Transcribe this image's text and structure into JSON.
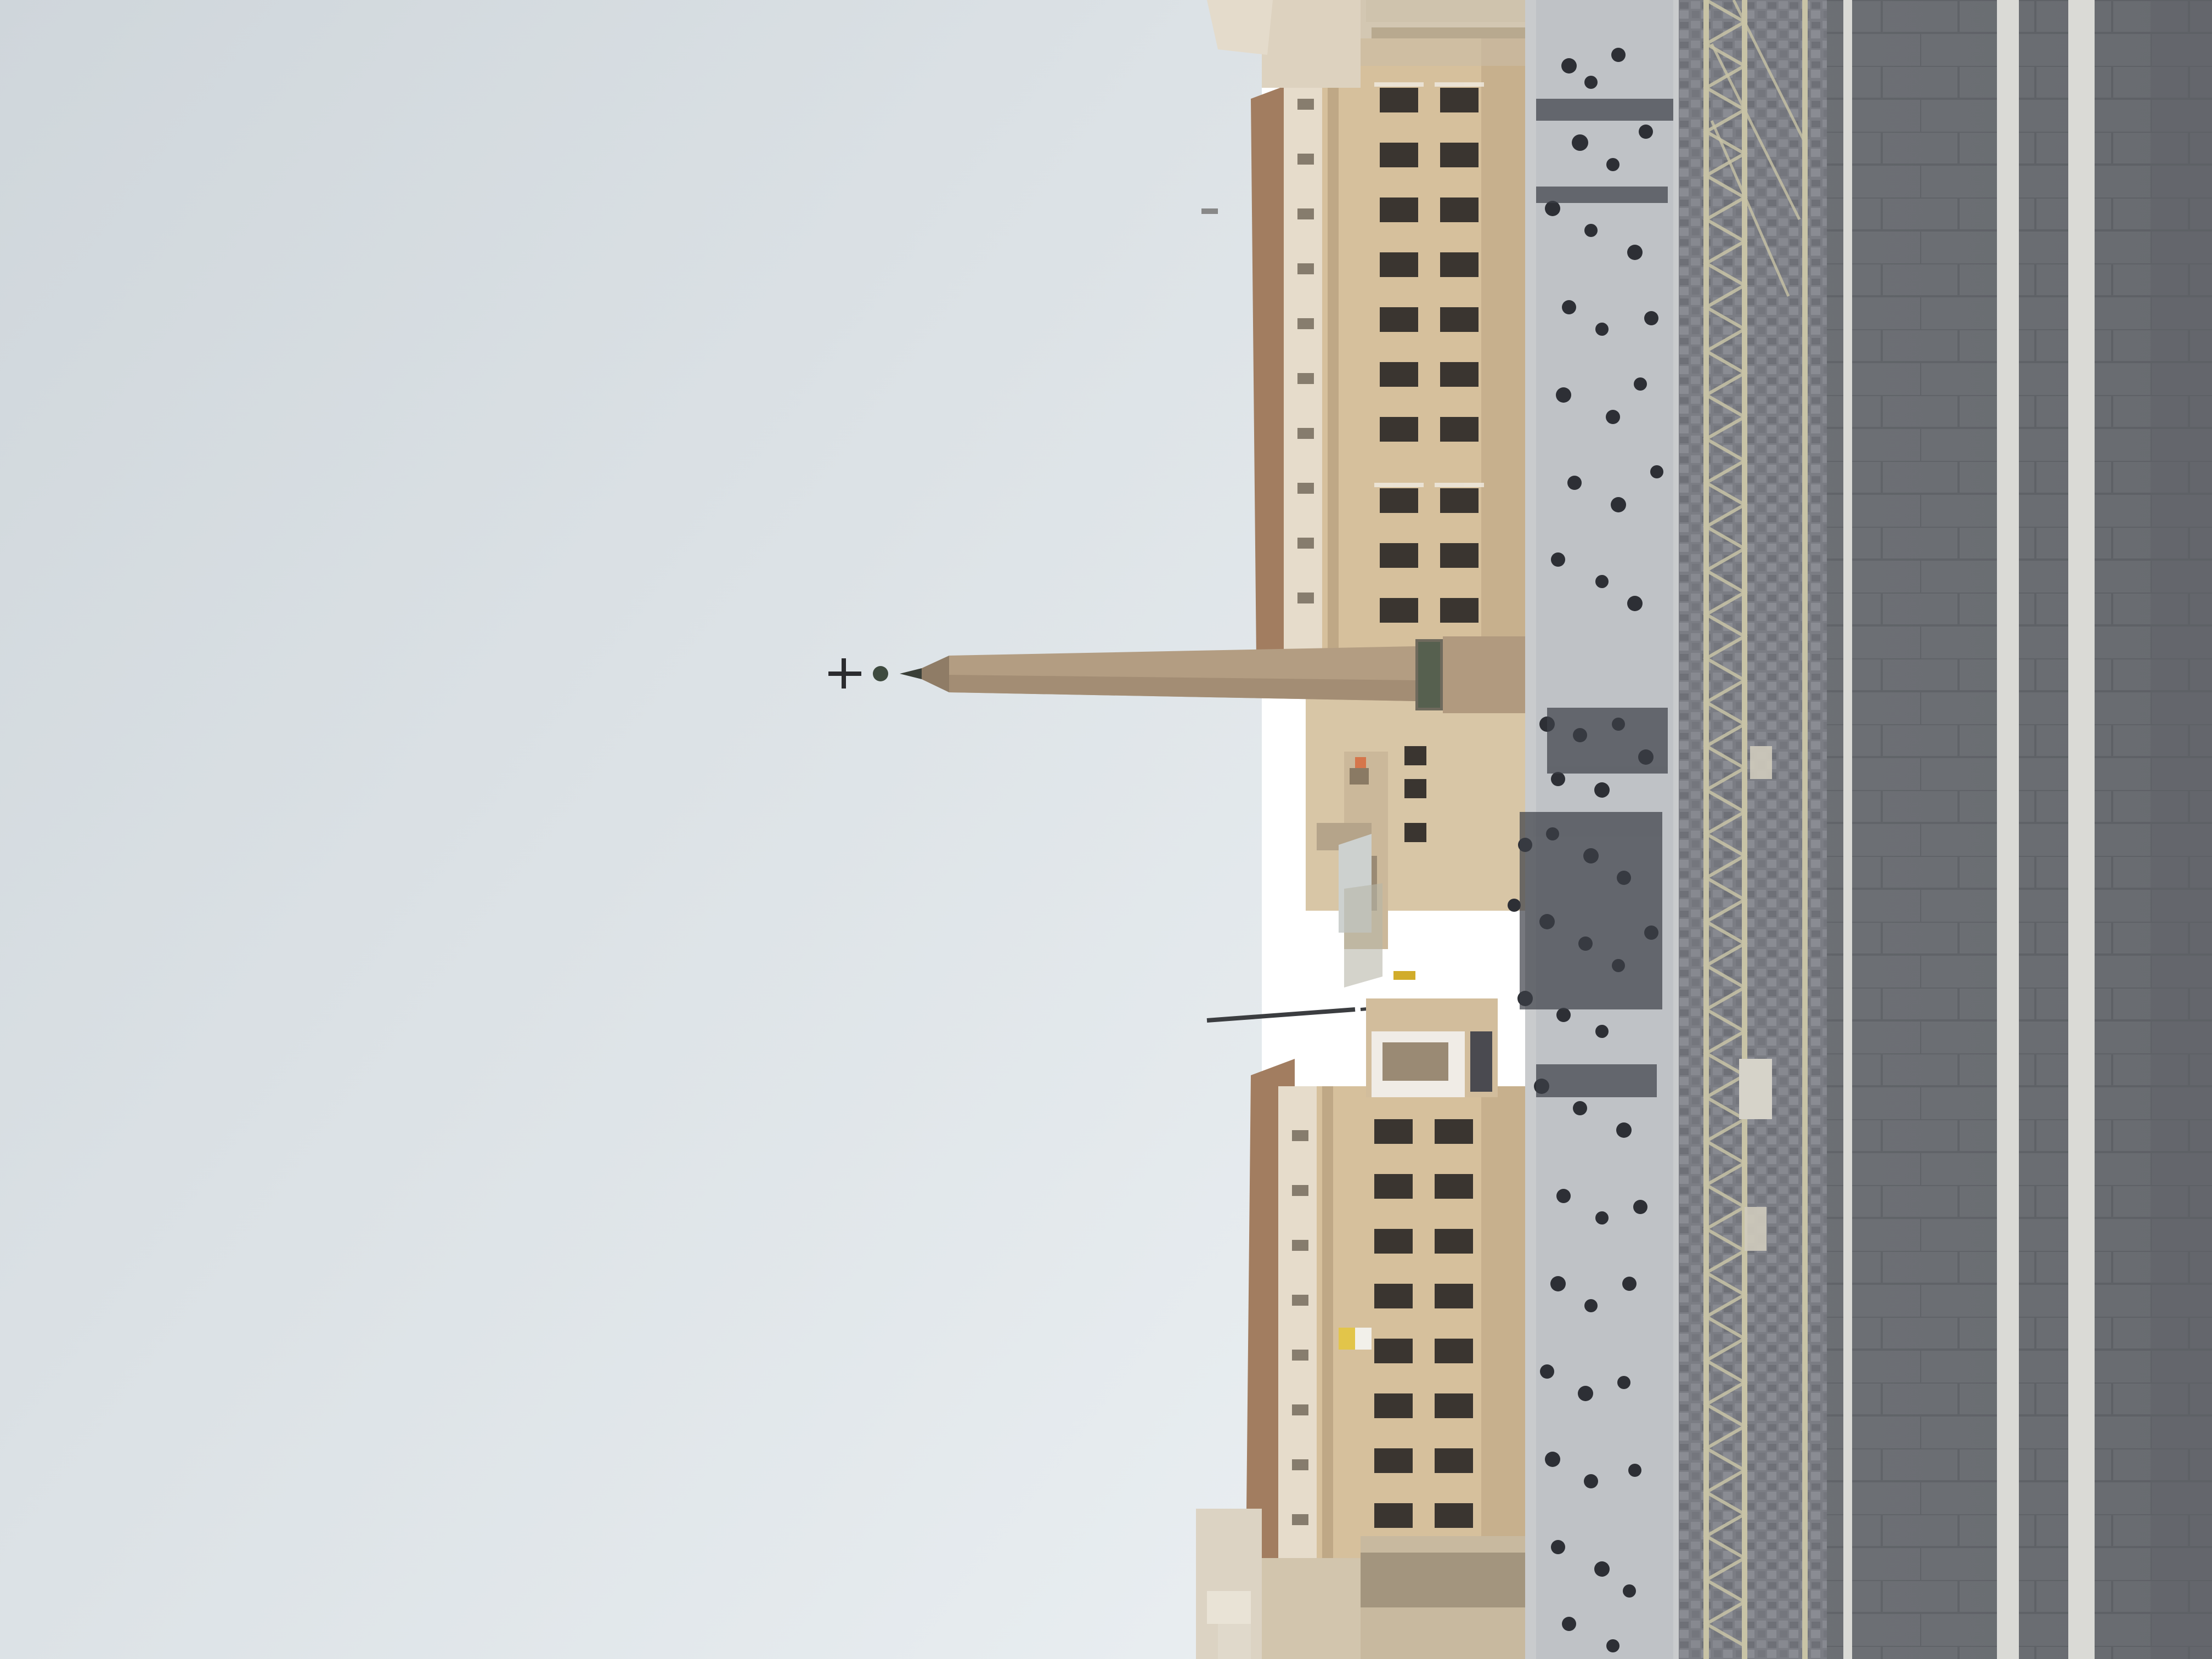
{
  "photo": {
    "orientation": "rotated-90-clockwise",
    "colors": {
      "sky_light": "#e6ebee",
      "sky_mid": "#d3d9dd",
      "sky_dark": "#bcc3c9",
      "building_facade": "#d6c09c",
      "building_shadow": "#b59e7c",
      "roof": "#9e7a5e",
      "obelisk": "#b39d82",
      "obelisk_shadow": "#8f7c66",
      "plaza_cobble": "#7e8087",
      "pavement": "#707276",
      "pavement_stripe": "#dadad6",
      "barrier": "#c8c3a6",
      "crowd": "#2d2f35",
      "window": "#3a3530",
      "flag": "#e2c54a"
    }
  }
}
